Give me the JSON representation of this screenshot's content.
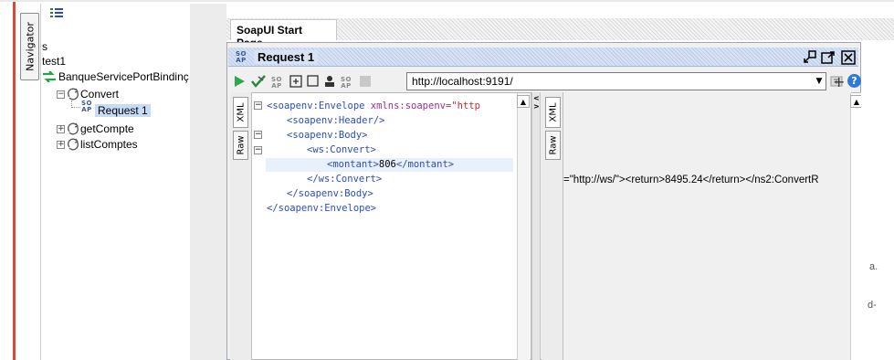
{
  "navigator": {
    "tab_label": "Navigator",
    "root_label": "s",
    "project": "test1",
    "binding": "BanqueServicePortBindinç",
    "operations": [
      {
        "label": "Convert",
        "expanded": true
      },
      {
        "label": "getCompte",
        "expanded": false
      },
      {
        "label": "listComptes",
        "expanded": false
      }
    ],
    "request": "Request 1"
  },
  "tabs": {
    "start_page": "SoapUI Start Page"
  },
  "request_window": {
    "badge": "SO AP",
    "title": "Request 1",
    "url": "http://localhost:9191/",
    "side_tabs": {
      "xml": "XML",
      "raw": "Raw"
    }
  },
  "request_xml": {
    "line1_tag": "<soapenv:Envelope",
    "line1_attr": " xmlns:soapenv=",
    "line1_val": "\"http",
    "line2": "<soapenv:Header/>",
    "line3": "<soapenv:Body>",
    "line4": "<ws:Convert>",
    "line5_open": "<montant>",
    "line5_val": "806",
    "line5_close": "</montant>",
    "line6": "</ws:Convert>",
    "line7": "</soapenv:Body>",
    "line8": "</soapenv:Envelope>"
  },
  "response": {
    "side_tabs": {
      "xml": "XML",
      "raw": "Raw"
    },
    "text": "=\"http://ws/\"><return>8495.24</return></ns2:ConvertR"
  },
  "right_fragments": [
    "a.",
    "d-"
  ],
  "colors": {
    "tag": "#2a4ac8",
    "attr": "#9b2d94",
    "string": "#c92a2a",
    "accent_blue": "#3a5a8a",
    "red_edge": "#d64a3a"
  }
}
